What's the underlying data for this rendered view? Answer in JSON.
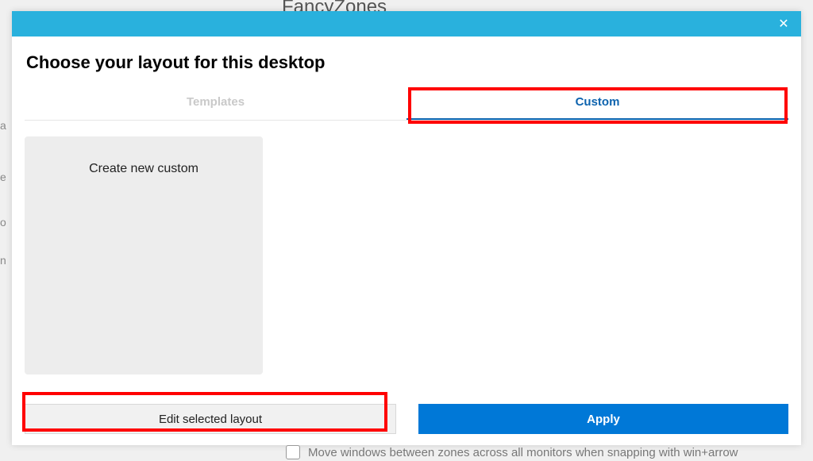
{
  "background": {
    "app_title": "FancyZones",
    "checkbox_label": "Move windows between zones across all monitors when snapping with win+arrow",
    "side_labels": [
      "a",
      "e",
      "o",
      "n"
    ]
  },
  "dialog": {
    "heading": "Choose your layout for this desktop",
    "tabs": {
      "templates": "Templates",
      "custom": "Custom"
    },
    "card": {
      "create_label": "Create new custom"
    },
    "buttons": {
      "edit": "Edit selected layout",
      "apply": "Apply"
    },
    "close": "✕"
  }
}
